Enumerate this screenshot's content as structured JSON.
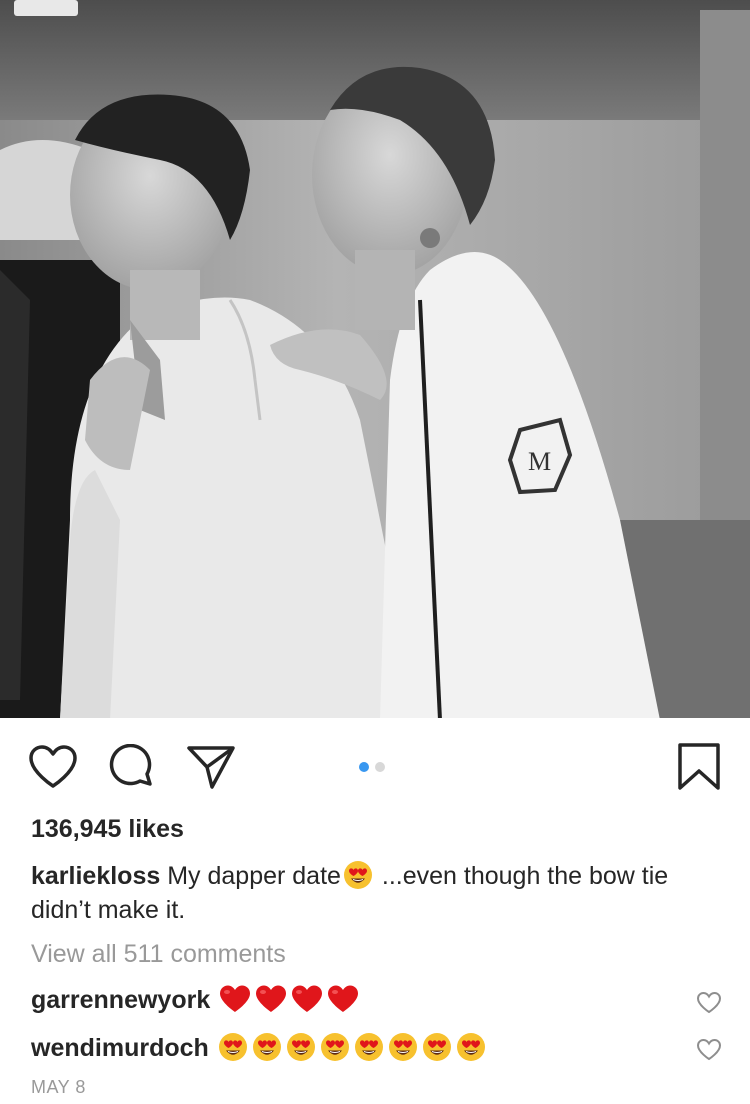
{
  "post": {
    "likes_text": "136,945 likes",
    "author": "karliekloss",
    "caption_part1": "My dapper date",
    "caption_part2": " ...even though the bow tie didn’t make it.",
    "view_all_comments": "View all 511 comments",
    "date": "MAY 8",
    "carousel": {
      "total": 2,
      "active_index": 0
    }
  },
  "comments": [
    {
      "username": "garrennewyork",
      "emojis": [
        "red-heart",
        "red-heart",
        "red-heart",
        "red-heart"
      ]
    },
    {
      "username": "wendimurdoch",
      "emojis": [
        "heart-eyes",
        "heart-eyes",
        "heart-eyes",
        "heart-eyes",
        "heart-eyes",
        "heart-eyes",
        "heart-eyes",
        "heart-eyes"
      ]
    }
  ],
  "icons": {
    "like": "heart-outline-icon",
    "comment": "comment-bubble-icon",
    "share": "paper-plane-icon",
    "save": "bookmark-icon",
    "comment_like": "small-heart-outline-icon"
  },
  "colors": {
    "text": "#262626",
    "muted": "#999999",
    "carousel_active": "#3897f0",
    "carousel_inactive": "#d8d8d8",
    "heart_red": "#e0161b",
    "emoji_yellow": "#f7c12e"
  }
}
